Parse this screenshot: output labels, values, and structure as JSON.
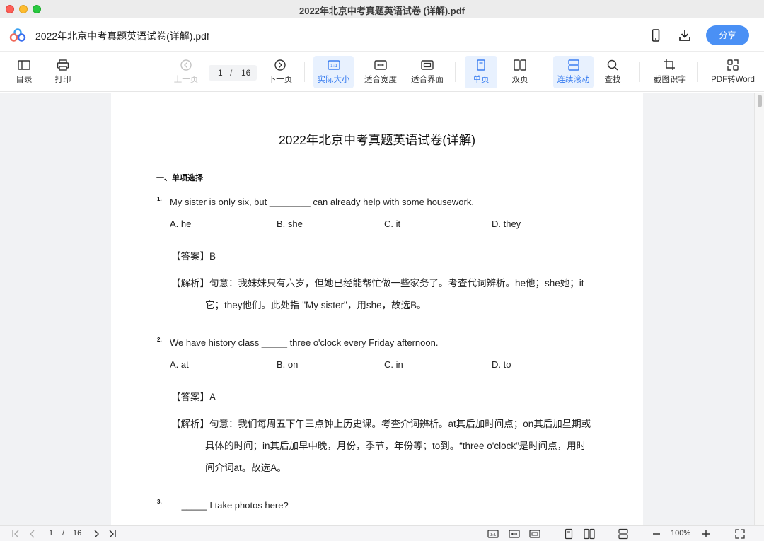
{
  "window": {
    "title": "2022年北京中考真题英语试卷 (详解).pdf"
  },
  "header": {
    "doc_title": "2022年北京中考真题英语试卷(详解).pdf",
    "share_label": "分享"
  },
  "toolbar": {
    "toc": "目录",
    "print": "打印",
    "prev": "上一页",
    "current_page": "1",
    "separator": "/",
    "total_pages": "16",
    "next": "下一页",
    "actual_size": "实际大小",
    "fit_width": "适合宽度",
    "fit_page": "适合界面",
    "single_page": "单页",
    "two_page": "双页",
    "continuous": "连续滚动",
    "find": "查找",
    "ocr": "截图识字",
    "to_word": "PDF转Word"
  },
  "document": {
    "title": "2022年北京中考真题英语试卷(详解)",
    "section": "一、单项选择",
    "questions": [
      {
        "num": "1.",
        "text": "My sister is only six, but ________ can already help with some housework.",
        "options": [
          "A. he",
          "B. she",
          "C. it",
          "D. they"
        ],
        "answer": "【答案】B",
        "explanation": [
          "【解析】句意：我妹妹只有六岁，但她已经能帮忙做一些家务了。考查代词辨析。he他；she她；it",
          "它；they他们。此处指 \"My sister\"，用she，故选B。"
        ]
      },
      {
        "num": "2.",
        "text": "We have history class _____ three o'clock every Friday afternoon.",
        "options": [
          "A. at",
          "B. on",
          "C. in",
          "D. to"
        ],
        "answer": "【答案】A",
        "explanation": [
          "【解析】句意：我们每周五下午三点钟上历史课。考查介词辨析。at其后加时间点；on其后加星期或",
          "具体的时间；in其后加早中晚，月份，季节，年份等；to到。“three o'clock”是时间点，用时",
          "间介词at。故选A。"
        ]
      },
      {
        "num": "3.",
        "text": "— _____ I take photos here?",
        "options": [],
        "answer": "",
        "explanation": []
      }
    ]
  },
  "statusbar": {
    "current_page": "1",
    "separator": "/",
    "total_pages": "16",
    "zoom": "100%"
  },
  "colors": {
    "accent": "#4a90f5",
    "active_bg": "#e8f1fe",
    "canvas_bg": "#f1f2f4"
  }
}
